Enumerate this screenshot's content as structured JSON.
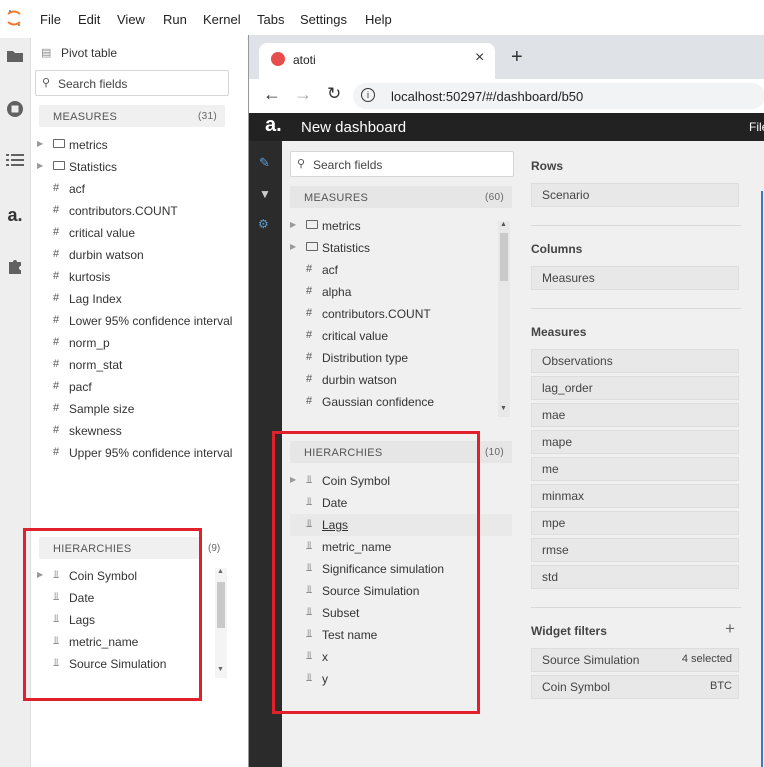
{
  "jupyter": {
    "menu": [
      "File",
      "Edit",
      "View",
      "Run",
      "Kernel",
      "Tabs",
      "Settings",
      "Help"
    ],
    "panel_title": "Pivot table",
    "search_placeholder": "Search fields",
    "measures_header": "MEASURES",
    "measures_count": "(31)",
    "measures": [
      {
        "label": "metrics",
        "type": "folder"
      },
      {
        "label": "Statistics",
        "type": "folder"
      },
      {
        "label": "acf",
        "type": "measure"
      },
      {
        "label": "contributors.COUNT",
        "type": "measure"
      },
      {
        "label": "critical value",
        "type": "measure"
      },
      {
        "label": "durbin watson",
        "type": "measure"
      },
      {
        "label": "kurtosis",
        "type": "measure"
      },
      {
        "label": "Lag Index",
        "type": "measure"
      },
      {
        "label": "Lower 95% confidence interval",
        "type": "measure"
      },
      {
        "label": "norm_p",
        "type": "measure"
      },
      {
        "label": "norm_stat",
        "type": "measure"
      },
      {
        "label": "pacf",
        "type": "measure"
      },
      {
        "label": "Sample size",
        "type": "measure"
      },
      {
        "label": "skewness",
        "type": "measure"
      },
      {
        "label": "Upper 95% confidence interval",
        "type": "measure"
      }
    ],
    "hierarchies_header": "HIERARCHIES",
    "hierarchies_count": "(9)",
    "hierarchies": [
      "Coin Symbol",
      "Date",
      "Lags",
      "metric_name",
      "Source Simulation"
    ]
  },
  "browser": {
    "tab_title": "atoti",
    "url": "localhost:50297/#/dashboard/b50"
  },
  "atoti": {
    "dashboard_title": "New dashboard",
    "menu_partial": "File",
    "search_placeholder": "Search fields",
    "measures_header": "MEASURES",
    "measures_count": "(60)",
    "measures": [
      {
        "label": "metrics",
        "type": "folder"
      },
      {
        "label": "Statistics",
        "type": "folder"
      },
      {
        "label": "acf",
        "type": "measure"
      },
      {
        "label": "alpha",
        "type": "measure"
      },
      {
        "label": "contributors.COUNT",
        "type": "measure"
      },
      {
        "label": "critical value",
        "type": "measure"
      },
      {
        "label": "Distribution type",
        "type": "measure"
      },
      {
        "label": "durbin watson",
        "type": "measure"
      },
      {
        "label": "Gaussian confidence",
        "type": "measure"
      }
    ],
    "hierarchies_header": "HIERARCHIES",
    "hierarchies_count": "(10)",
    "hierarchies": [
      "Coin Symbol",
      "Date",
      "Lags",
      "metric_name",
      "Significance simulation",
      "Source Simulation",
      "Subset",
      "Test name",
      "x",
      "y"
    ],
    "rows_title": "Rows",
    "rows": [
      "Scenario"
    ],
    "columns_title": "Columns",
    "columns": [
      "Measures"
    ],
    "measures_title": "Measures",
    "selected_measures": [
      "Observations",
      "lag_order",
      "mae",
      "mape",
      "me",
      "minmax",
      "mpe",
      "rmse",
      "std"
    ],
    "widget_filters_title": "Widget filters",
    "filters": [
      {
        "name": "Source Simulation",
        "value": "4 selected"
      },
      {
        "name": "Coin Symbol",
        "value": "BTC"
      }
    ]
  },
  "colors": {
    "highlight": "#e0202a",
    "atoti_header": "#222222",
    "accent": "#1a73e8"
  }
}
